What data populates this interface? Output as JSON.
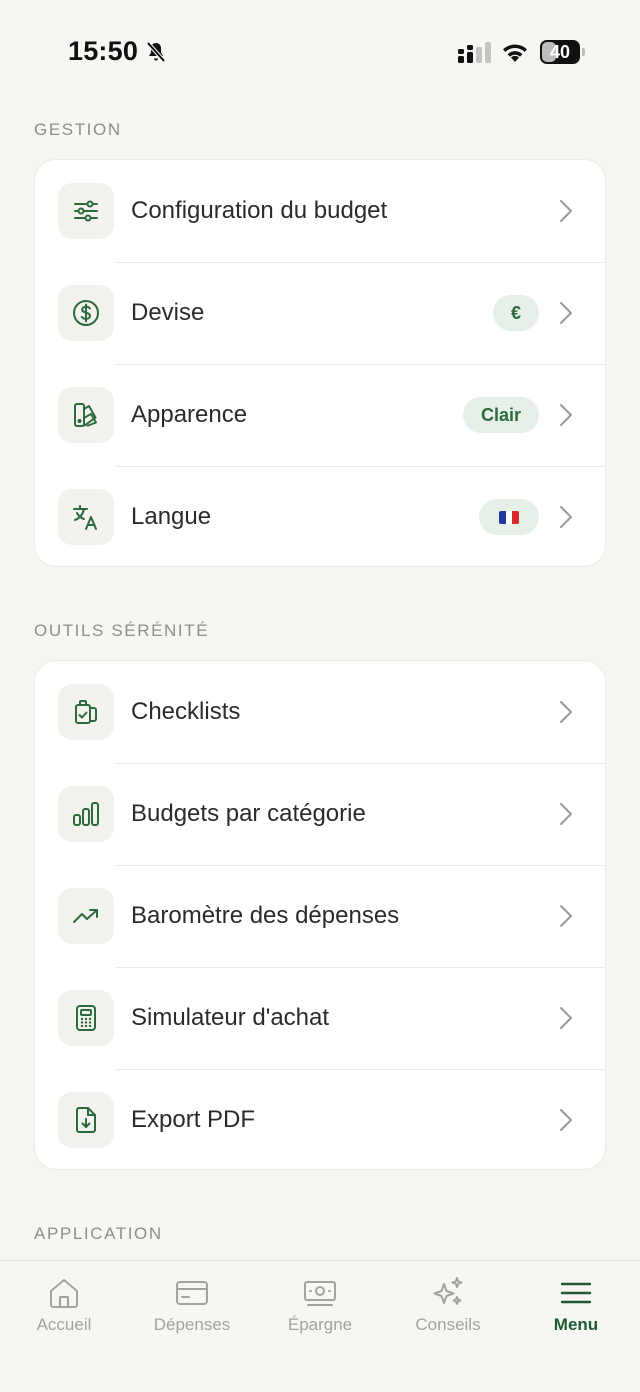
{
  "status_bar": {
    "time": "15:50",
    "battery": "40",
    "battery_level": 0.4
  },
  "sections": {
    "gestion": {
      "title": "GESTION",
      "items": [
        {
          "label": "Configuration du budget",
          "icon": "sliders-icon"
        },
        {
          "label": "Devise",
          "icon": "dollar-circle-icon",
          "badge": "€"
        },
        {
          "label": "Apparence",
          "icon": "palette-icon",
          "badge": "Clair"
        },
        {
          "label": "Langue",
          "icon": "translate-icon",
          "badge_icon": "flag-fr-icon"
        }
      ]
    },
    "outils": {
      "title": "OUTILS SÉRÉNITÉ",
      "items": [
        {
          "label": "Checklists",
          "icon": "clipboard-check-icon"
        },
        {
          "label": "Budgets par catégorie",
          "icon": "bar-chart-icon"
        },
        {
          "label": "Baromètre des dépenses",
          "icon": "trending-up-icon"
        },
        {
          "label": "Simulateur d'achat",
          "icon": "calculator-icon"
        },
        {
          "label": "Export PDF",
          "icon": "file-download-icon"
        }
      ]
    },
    "application": {
      "title": "APPLICATION"
    }
  },
  "tab_bar": {
    "tabs": [
      {
        "label": "Accueil",
        "icon": "home-icon"
      },
      {
        "label": "Dépenses",
        "icon": "card-icon"
      },
      {
        "label": "Épargne",
        "icon": "banknote-icon"
      },
      {
        "label": "Conseils",
        "icon": "sparkles-icon"
      },
      {
        "label": "Menu",
        "icon": "menu-icon"
      }
    ],
    "active": "Menu"
  },
  "colors": {
    "accent": "#2d6a3e",
    "background": "#f7f6f3",
    "card": "#ffffff",
    "badge_bg": "#e6efe8",
    "tab_inactive": "#a3a3a3"
  }
}
